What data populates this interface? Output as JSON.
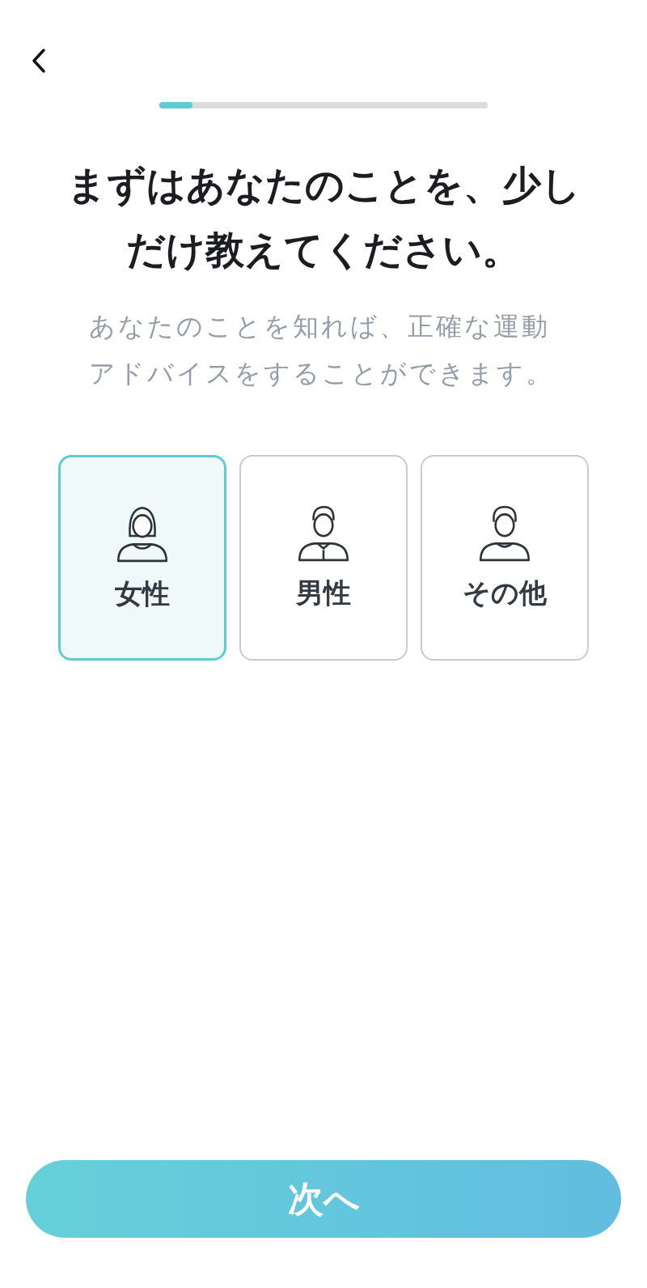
{
  "progress": {
    "level": 0.1
  },
  "title": "まずはあなたのことを、少しだけ教えてください。",
  "subtitle": "あなたのことを知れば、正確な運動アドバイスをすることができます。",
  "options": [
    {
      "label": "女性",
      "kind": "woman",
      "selected": true
    },
    {
      "label": "男性",
      "kind": "man",
      "selected": false
    },
    {
      "label": "その他",
      "kind": "other",
      "selected": false
    }
  ],
  "next_button": "次へ"
}
